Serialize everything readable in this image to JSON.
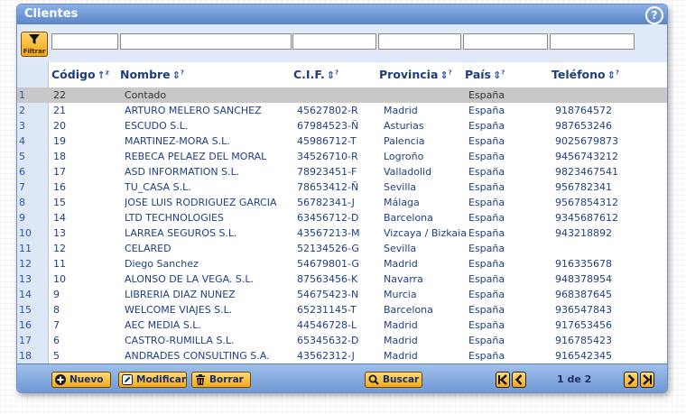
{
  "window": {
    "title": "Clientes",
    "help_symbol": "?"
  },
  "filter": {
    "button_label": "Filtrar"
  },
  "columns": {
    "codigo": "Código",
    "nombre": "Nombre",
    "cif": "C.I.F.",
    "provincia": "Provincia",
    "pais": "País",
    "telefono": "Teléfono"
  },
  "rows": [
    {
      "num": "1",
      "codigo": "22",
      "nombre": "Contado",
      "cif": "",
      "provincia": "",
      "pais": "España",
      "telefono": "",
      "selected": true
    },
    {
      "num": "2",
      "codigo": "21",
      "nombre": "ARTURO MELERO SANCHEZ",
      "cif": "45627802-R",
      "provincia": "Madrid",
      "pais": "España",
      "telefono": "918764572"
    },
    {
      "num": "3",
      "codigo": "20",
      "nombre": "ESCUDO S.L.",
      "cif": "67984523-Ñ",
      "provincia": "Asturias",
      "pais": "España",
      "telefono": "987653246"
    },
    {
      "num": "4",
      "codigo": "19",
      "nombre": "MARTINEZ-MORA S.L.",
      "cif": "45986712-T",
      "provincia": "Palencia",
      "pais": "España",
      "telefono": "9025679873"
    },
    {
      "num": "5",
      "codigo": "18",
      "nombre": "REBECA PELAEZ DEL MORAL",
      "cif": "34526710-R",
      "provincia": "Logroño",
      "pais": "España",
      "telefono": "9456743212"
    },
    {
      "num": "6",
      "codigo": "17",
      "nombre": "ASD INFORMATION S.L.",
      "cif": "78923451-F",
      "provincia": "Valladolid",
      "pais": "España",
      "telefono": "9823467541"
    },
    {
      "num": "7",
      "codigo": "16",
      "nombre": "TU_CASA S.L.",
      "cif": "78653412-Ñ",
      "provincia": "Sevilla",
      "pais": "España",
      "telefono": "956782341"
    },
    {
      "num": "8",
      "codigo": "15",
      "nombre": "JOSE LUIS RODRIGUEZ GARCIA",
      "cif": "56782341-J",
      "provincia": "Málaga",
      "pais": "España",
      "telefono": "9567854312"
    },
    {
      "num": "9",
      "codigo": "14",
      "nombre": "LTD TECHNOLOGIES",
      "cif": "63456712-D",
      "provincia": "Barcelona",
      "pais": "España",
      "telefono": "9345687612"
    },
    {
      "num": "10",
      "codigo": "13",
      "nombre": "LARREA SEGUROS S.L.",
      "cif": "43567213-M",
      "provincia": "Vizcaya / Bizkaia",
      "pais": "España",
      "telefono": "943218892"
    },
    {
      "num": "11",
      "codigo": "12",
      "nombre": "CELARED",
      "cif": "52134526-G",
      "provincia": "Sevilla",
      "pais": "España",
      "telefono": ""
    },
    {
      "num": "12",
      "codigo": "11",
      "nombre": "Diego Sanchez",
      "cif": "54679801-G",
      "provincia": "Madrid",
      "pais": "España",
      "telefono": "916335678"
    },
    {
      "num": "13",
      "codigo": "10",
      "nombre": "ALONSO DE LA VEGA. S.L.",
      "cif": "87563456-K",
      "provincia": "Navarra",
      "pais": "España",
      "telefono": "948378954"
    },
    {
      "num": "14",
      "codigo": "9",
      "nombre": "LIBRERIA DIAZ NUNEZ",
      "cif": "54675423-N",
      "provincia": "Murcia",
      "pais": "España",
      "telefono": "968387645"
    },
    {
      "num": "15",
      "codigo": "8",
      "nombre": "WELCOME VIAJES S.L.",
      "cif": "65231145-T",
      "provincia": "Barcelona",
      "pais": "España",
      "telefono": "936547843"
    },
    {
      "num": "16",
      "codigo": "7",
      "nombre": "AEC MEDIA S.L.",
      "cif": "44546728-L",
      "provincia": "Madrid",
      "pais": "España",
      "telefono": "917653456"
    },
    {
      "num": "17",
      "codigo": "6",
      "nombre": "CASTRO-RUMILLA S.L.",
      "cif": "65345632-D",
      "provincia": "Madrid",
      "pais": "España",
      "telefono": "916785423"
    },
    {
      "num": "18",
      "codigo": "5",
      "nombre": "ANDRADES CONSULTING S.A.",
      "cif": "43562312-J",
      "provincia": "Madrid",
      "pais": "España",
      "telefono": "916542345"
    }
  ],
  "toolbar": {
    "nuevo": "Nuevo",
    "modificar": "Modificar",
    "borrar": "Borrar",
    "buscar": "Buscar",
    "page_info": "1 de 2"
  },
  "icons": {
    "filter": "funnel-icon",
    "nuevo": "plus-circle-icon",
    "modificar": "edit-icon",
    "borrar": "trash-icon",
    "buscar": "magnifier-icon",
    "first": "first-page-icon",
    "prev": "previous-page-icon",
    "next": "next-page-icon",
    "last": "last-page-icon"
  },
  "colors": {
    "titlebar": "#6f97d4",
    "button": "#f5b52e",
    "selected_row": "#c8c8c8",
    "text": "#1e3f84"
  }
}
